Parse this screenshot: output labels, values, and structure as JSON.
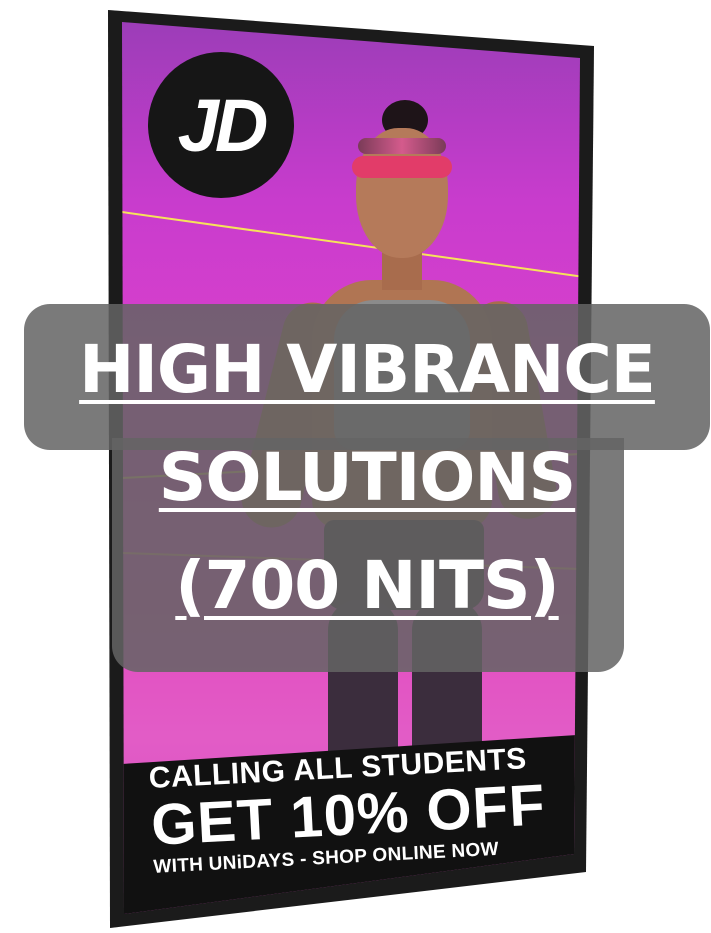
{
  "logo": {
    "text": "JD"
  },
  "promo": {
    "line_1": "CALLING ALL STUDENTS",
    "line_2": "GET 10% OFF",
    "line_3": "WITH UNiDAYS - SHOP ONLINE NOW"
  },
  "caption": {
    "line_1": "HIGH VIBRANCE",
    "line_2": "SOLUTIONS",
    "line_3": "(700 NITS)"
  },
  "colors": {
    "screen_top": "#9c3db8",
    "screen_mid": "#e041cc",
    "banner": "#111111",
    "overlay": "#646464",
    "text": "#ffffff"
  }
}
